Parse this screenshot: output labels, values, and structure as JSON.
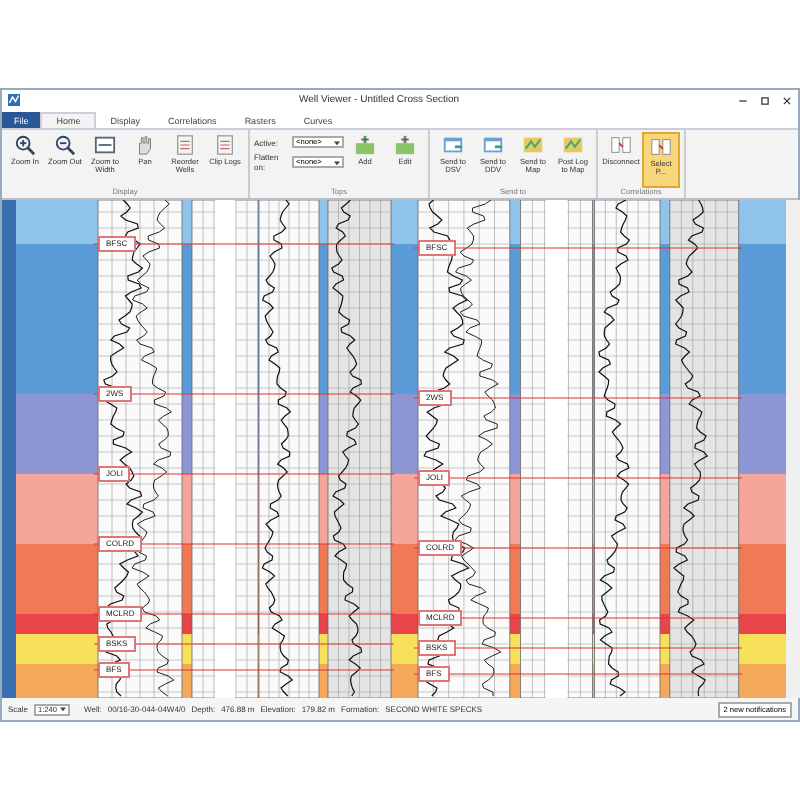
{
  "window": {
    "title": "Well Viewer - Untitled Cross Section"
  },
  "file_menu": {
    "label": "File"
  },
  "tabs": [
    {
      "label": "Home",
      "selected": true
    },
    {
      "label": "Display",
      "selected": false
    },
    {
      "label": "Correlations",
      "selected": false
    },
    {
      "label": "Rasters",
      "selected": false
    },
    {
      "label": "Curves",
      "selected": false
    }
  ],
  "ribbon": [
    {
      "label": "Display",
      "buttons": [
        {
          "label": "Zoom In",
          "selected": false
        },
        {
          "label": "Zoom Out",
          "selected": false
        },
        {
          "label": "Zoom to Width",
          "selected": false
        },
        {
          "label": "Pan",
          "selected": false
        },
        {
          "label": "Reorder Wells",
          "selected": false
        },
        {
          "label": "Clip Logs",
          "selected": false
        }
      ]
    },
    {
      "label": "Tops",
      "fields": [
        {
          "label": "Active:",
          "value": "<none>"
        },
        {
          "label": "Flatten on:",
          "value": "<none>"
        }
      ],
      "buttons": [
        {
          "label": "Add",
          "selected": false
        },
        {
          "label": "Edit",
          "selected": false
        }
      ]
    },
    {
      "label": "Send to",
      "buttons": [
        {
          "label": "Send to DSV",
          "selected": false
        },
        {
          "label": "Send to DDV",
          "selected": false
        },
        {
          "label": "Send to Map",
          "selected": false
        },
        {
          "label": "Post Log to Map",
          "selected": false
        }
      ]
    },
    {
      "label": "Correlations",
      "buttons": [
        {
          "label": "Disconnect",
          "selected": false
        },
        {
          "label": "Select P...",
          "selected": true
        }
      ]
    }
  ],
  "zones": [
    {
      "color": "#8fc3ea"
    },
    {
      "color": "#5b9bd8"
    },
    {
      "color": "#8d97d6"
    },
    {
      "color": "#f6a59a"
    },
    {
      "color": "#f07a55"
    },
    {
      "color": "#e8454a"
    },
    {
      "color": "#f7e05a"
    },
    {
      "color": "#f4a85a"
    }
  ],
  "wells": [
    {
      "tops": [
        "BFSC",
        "2WS",
        "JOLI",
        "COLRD",
        "MCLRD",
        "BSKS",
        "BFS"
      ]
    },
    {
      "tops": [
        "BFSC",
        "2WS",
        "JOLI",
        "COLRD",
        "MCLRD",
        "BSKS",
        "BFS"
      ]
    }
  ],
  "status_bar": {
    "scale_label": "Scale",
    "scale": "1:240",
    "well_label": "Well:",
    "well": "00/16-30-044-04W4/0",
    "depth_label": "Depth:",
    "depth": "476.88 m",
    "elevation_label": "Elevation:",
    "elevation": "179.82 m",
    "formation_label": "Formation:",
    "formation": "SECOND WHITE SPECKS",
    "notifications": "2 new notifications"
  }
}
